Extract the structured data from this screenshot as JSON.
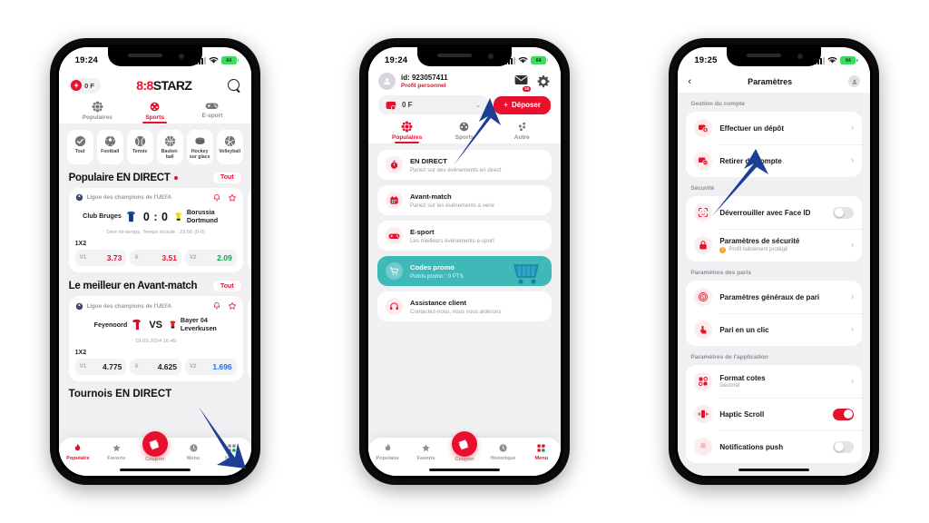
{
  "phone1": {
    "status": {
      "time": "19:24",
      "battery": "64"
    },
    "header": {
      "balance": "0 F",
      "logo_red": "8:8",
      "logo_black": "STARZ",
      "search_icon": "search-icon"
    },
    "tabs": [
      {
        "label": "Populaires",
        "icon": "flower-icon",
        "active": false
      },
      {
        "label": "Sports",
        "icon": "ball-icon",
        "active": true
      },
      {
        "label": "E-sport",
        "icon": "gamepad-icon",
        "active": false
      }
    ],
    "categories": [
      {
        "label": "Tout",
        "icon": "all-icon"
      },
      {
        "label": "Football",
        "icon": "football-icon"
      },
      {
        "label": "Tennis",
        "icon": "tennis-icon"
      },
      {
        "label": "Basket-ball",
        "icon": "basketball-icon"
      },
      {
        "label": "Hockey sur glace",
        "icon": "hockey-icon"
      },
      {
        "label": "Volleyball",
        "icon": "volleyball-icon"
      }
    ],
    "section_live": {
      "title": "Populaire EN DIRECT",
      "all_label": "Tout"
    },
    "match_live": {
      "league": "Ligue des champions de l'UEFA",
      "home": "Club Bruges",
      "away": "Borussia Dortmund",
      "score": "0 : 0",
      "status": "1ère mi-temps, Temps écoulé : 23:56 (0-0)",
      "market": "1X2",
      "odds": [
        {
          "key": "V1",
          "value": "3.73",
          "color": "red"
        },
        {
          "key": "X",
          "value": "3.51",
          "color": "red"
        },
        {
          "key": "V2",
          "value": "2.09",
          "color": "grn"
        }
      ]
    },
    "section_pre": {
      "title": "Le meilleur en Avant-match",
      "all_label": "Tout"
    },
    "match_pre": {
      "league": "Ligue des champions de l'UEFA",
      "home": "Feyenoord",
      "away": "Bayer 04 Leverkusen",
      "vs": "VS",
      "datetime": "19.09.2024 16:45",
      "market": "1X2",
      "odds": [
        {
          "key": "V1",
          "value": "4.775",
          "color": "blk"
        },
        {
          "key": "X",
          "value": "4.625",
          "color": "blk"
        },
        {
          "key": "V2",
          "value": "1.696",
          "color": "blu"
        }
      ]
    },
    "cut_section": "Tournois EN DIRECT",
    "bottom_nav": [
      {
        "label": "Populaire",
        "icon": "flame-icon",
        "active": true
      },
      {
        "label": "Favoris",
        "icon": "star-icon",
        "active": false
      },
      {
        "label": "Coupon",
        "icon": "ticket-icon",
        "active": false
      },
      {
        "label": "Historique",
        "icon": "clock-icon",
        "active": false
      },
      {
        "label": "Menu",
        "icon": "grid-icon",
        "active": false
      }
    ]
  },
  "phone2": {
    "status": {
      "time": "19:24",
      "battery": "64"
    },
    "user": {
      "id": "id: 923057411",
      "profile": "Profil personnel",
      "avatar_icon": "user-avatar-icon"
    },
    "header_icons": {
      "mail_icon": "mail-icon",
      "mail_badge": "16",
      "gear_icon": "gear-icon"
    },
    "wallet": {
      "amount": "0 F",
      "wallet_icon": "wallet-icon",
      "chevron": "chevron-down-icon"
    },
    "deposit_button": {
      "label": "Déposer",
      "plus": "+"
    },
    "tabs": [
      {
        "label": "Populaires",
        "icon": "flower-icon",
        "active": true
      },
      {
        "label": "Sports",
        "icon": "ball-icon",
        "active": false
      },
      {
        "label": "Autre",
        "icon": "dots-icon",
        "active": false
      }
    ],
    "menu_items": [
      {
        "title": "EN DIRECT",
        "subtitle": "Pariez sur des événements en direct",
        "icon": "stopwatch-icon",
        "highlight": false
      },
      {
        "title": "Avant-match",
        "subtitle": "Pariez sur les événements à venir",
        "icon": "calendar-icon",
        "highlight": false
      },
      {
        "title": "E-sport",
        "subtitle": "Les meilleurs événements e-sport",
        "icon": "gamepad-icon",
        "highlight": false
      },
      {
        "title": "Codes promo",
        "subtitle": "Points promo : 0 PTS",
        "icon": "cart-icon",
        "highlight": true
      },
      {
        "title": "Assistance client",
        "subtitle": "Contactez-nous, nous vous aiderons",
        "icon": "headset-icon",
        "highlight": false
      }
    ],
    "bottom_nav": [
      {
        "label": "Populaire",
        "icon": "flame-icon",
        "active": false
      },
      {
        "label": "Favoris",
        "icon": "star-icon",
        "active": false
      },
      {
        "label": "Coupon",
        "icon": "ticket-icon",
        "active": false
      },
      {
        "label": "Historique",
        "icon": "clock-icon",
        "active": false
      },
      {
        "label": "Menu",
        "icon": "grid-icon",
        "active": true
      }
    ]
  },
  "phone3": {
    "status": {
      "time": "19:25",
      "battery": "64"
    },
    "header": {
      "title": "Paramètres",
      "back_icon": "chevron-left-icon",
      "avatar_icon": "user-avatar-icon"
    },
    "groups": [
      {
        "label": "Gestion du compte",
        "rows": [
          {
            "title": "Effectuer un dépôt",
            "subtitle": "",
            "icon": "card-plus-icon",
            "control": "chevron"
          },
          {
            "title": "Retirer du compte",
            "subtitle": "",
            "icon": "card-minus-icon",
            "control": "chevron"
          }
        ]
      },
      {
        "label": "Sécurité",
        "rows": [
          {
            "title": "Déverrouiller avec Face ID",
            "subtitle": "",
            "icon": "faceid-icon",
            "control": "toggle-off"
          },
          {
            "title": "Paramètres de sécurité",
            "subtitle": "Profil faiblement protégé",
            "icon": "lock-icon",
            "control": "chevron",
            "warn": "!"
          }
        ]
      },
      {
        "label": "Paramètres des paris",
        "rows": [
          {
            "title": "Paramètres généraux de pari",
            "subtitle": "",
            "icon": "coin-icon",
            "control": "chevron"
          },
          {
            "title": "Pari en un clic",
            "subtitle": "",
            "icon": "tap-icon",
            "control": "chevron"
          }
        ]
      },
      {
        "label": "Paramètres de l'application",
        "rows": [
          {
            "title": "Format cotes",
            "subtitle": "Décimal",
            "icon": "squares-icon",
            "control": "chevron"
          },
          {
            "title": "Haptic Scroll",
            "subtitle": "",
            "icon": "vibrate-icon",
            "control": "toggle-on"
          },
          {
            "title": "Notifications push",
            "subtitle": "",
            "icon": "bell-icon",
            "control": "toggle-off"
          }
        ]
      }
    ]
  },
  "colors": {
    "brand_red": "#e8112d",
    "teal": "#3fb8b8",
    "green": "#12a150",
    "blue": "#1b6ef3",
    "arrow_blue": "#1c3f94"
  }
}
